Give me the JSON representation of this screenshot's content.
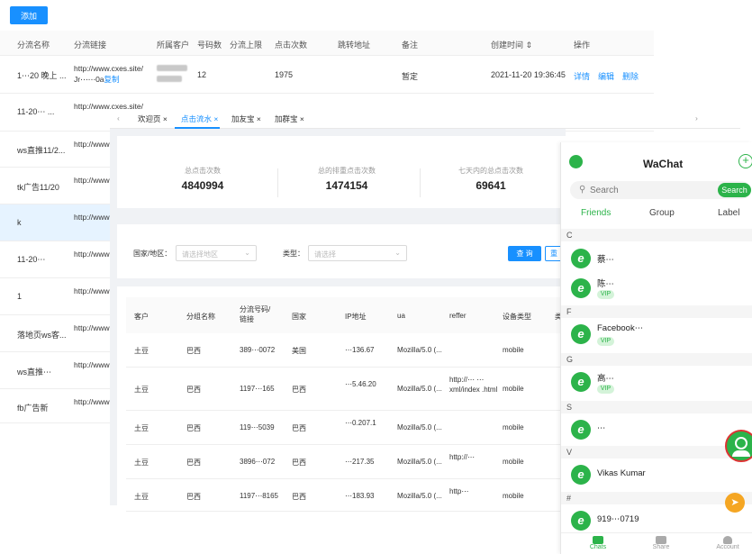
{
  "bg": {
    "add_label": "添加",
    "headers": [
      "分流名称",
      "分流链接",
      "所属客户",
      "号码数",
      "分流上限",
      "点击次数",
      "跳转地址",
      "备注",
      "创建时间 ⇕",
      "操作"
    ],
    "row1": {
      "name": "1⋯20 晚上 ...",
      "link1": "http://www.cxes.site/",
      "link2": "Jr⋯⋯0a",
      "copy": "复制",
      "count": "12",
      "clicks": "1975",
      "note": "暂定",
      "created": "2021-11-20 19:36:45",
      "detail": "详情",
      "edit": "编辑",
      "delete": "删除"
    },
    "row2": {
      "name": "11-20⋯ ...",
      "link1": "http://www.cxes.site/"
    },
    "rows": [
      {
        "name": "ws直推11/2...",
        "link": "http://www"
      },
      {
        "name": "tk广告11/20",
        "link": "http://www"
      },
      {
        "name": "k",
        "link": "http://www"
      },
      {
        "name": "11-20⋯",
        "link": "http://www"
      },
      {
        "name": "1",
        "link": "http://www"
      },
      {
        "name": "落地页ws客...",
        "link": "http://www"
      },
      {
        "name": "ws直推⋯",
        "link": "http://www"
      },
      {
        "name": "fb广告新",
        "link": "http://www"
      }
    ]
  },
  "tabs": [
    "欢迎页",
    "点击流水",
    "加友宝",
    "加群宝"
  ],
  "stats": [
    {
      "label": "总点击次数",
      "value": "4840994"
    },
    {
      "label": "总的排重点击次数",
      "value": "1474154"
    },
    {
      "label": "七天内的总点击次数",
      "value": "69641"
    }
  ],
  "filters": {
    "region_label": "国家/地区：",
    "region_placeholder": "请选择地区",
    "type_label": "类型：",
    "type_placeholder": "请选择",
    "query": "查 询",
    "reset": "重"
  },
  "table": {
    "headers": [
      "客户",
      "分组名称",
      "分流号码/链接",
      "国家",
      "IP地址",
      "ua",
      "reffer",
      "设备类型",
      "类"
    ],
    "rows": [
      {
        "customer": "土豆",
        "group": "巴西",
        "number": "389⋯0072",
        "country": "美国",
        "ip": "⋯136.67",
        "ua": "Mozilla/5.0 (...",
        "reffer": "",
        "device": "mobile"
      },
      {
        "customer": "土豆",
        "group": "巴西",
        "number": "1197⋯165",
        "country": "巴西",
        "ip": "⋯5.46.20",
        "ua": "Mozilla/5.0 (...",
        "reffer": "http://⋯ ⋯xml/index .html",
        "device": "mobile"
      },
      {
        "customer": "土豆",
        "group": "巴西",
        "number": "119⋯5039",
        "country": "巴西",
        "ip": "⋯0.207.1",
        "ua": "Mozilla/5.0 (...",
        "reffer": "",
        "device": "mobile"
      },
      {
        "customer": "土豆",
        "group": "巴西",
        "number": "3896⋯072",
        "country": "巴西",
        "ip": "⋯217.35",
        "ua": "Mozilla/5.0 (...",
        "reffer": "http://⋯",
        "device": "mobile"
      },
      {
        "customer": "土豆",
        "group": "巴西",
        "number": "1197⋯8165",
        "country": "巴西",
        "ip": "⋯183.93",
        "ua": "Mozilla/5.0 (...",
        "reffer": "http⋯",
        "device": "mobile"
      }
    ]
  },
  "chat": {
    "title": "WaChat",
    "search_placeholder": "Search",
    "search_btn": "Search",
    "tabs": [
      "Friends",
      "Group",
      "Label"
    ],
    "sections": [
      {
        "letter": "C"
      },
      {
        "letter": "F"
      },
      {
        "letter": "G"
      },
      {
        "letter": "S"
      },
      {
        "letter": "V"
      },
      {
        "letter": "#"
      }
    ],
    "friends": [
      {
        "name": "蔡⋯",
        "vip": ""
      },
      {
        "name": "陈⋯",
        "vip": "VIP"
      },
      {
        "name": "Facebook⋯",
        "vip": "VIP"
      },
      {
        "name": "高⋯",
        "vip": "VIP"
      },
      {
        "name": "⋯",
        "vip": ""
      },
      {
        "name": "Vikas Kumar",
        "vip": ""
      },
      {
        "name": "919⋯0719",
        "vip": ""
      }
    ],
    "bottom": [
      "Chats",
      "Share",
      "Account"
    ],
    "accent": "#2cb34a"
  }
}
